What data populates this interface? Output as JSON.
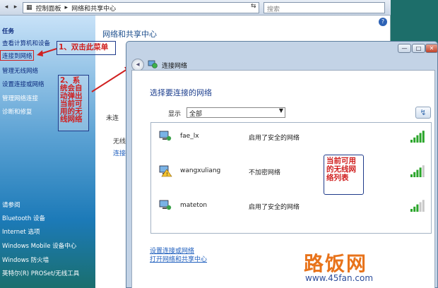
{
  "addressbar": {
    "back_label": "◂",
    "forward_label": "▸",
    "crumb1": "控制面板",
    "crumb2": "网络和共享中心",
    "search_placeholder": "搜索"
  },
  "sidebar": {
    "tasks_label": "任务",
    "items": [
      "查看计算机和设备",
      "连接到网络",
      "管理无线网络",
      "设置连接或网络",
      "管理网络连接",
      "诊断和修复"
    ],
    "see_also_label": "请参阅",
    "see_also": [
      "Bluetooth 设备",
      "Internet 选项",
      "Windows Mobile 设备中心",
      "Windows 防火墙",
      "英特尔(R) PROSet/无线工具"
    ]
  },
  "main": {
    "title": "网络和共享中心",
    "frag1": "未连",
    "frag2": "无线",
    "frag3": "连接"
  },
  "annotations": {
    "step1": "1、双击此菜单",
    "step2": "2、系统会自动弹出当前可用的无线网络",
    "step3": "当前可用的无线网络列表"
  },
  "dialog": {
    "title": "连接网络",
    "heading": "选择要连接的网络",
    "show_label": "显示",
    "show_value": "全部",
    "refresh_icon": "refresh-icon",
    "networks": [
      {
        "name": "fae_lx",
        "status": "启用了安全的网络",
        "signal": 5,
        "secured": true
      },
      {
        "name": "wangxuliang",
        "status": "不加密网络",
        "signal": 4,
        "secured": false
      },
      {
        "name": "mateton",
        "status": "启用了安全的网络",
        "signal": 3,
        "secured": true
      }
    ],
    "link1": "设置连接或网络",
    "link2": "打开网络和共享中心"
  },
  "watermark": {
    "text": "路饭网",
    "url": "www.45fan.com"
  },
  "colors": {
    "annotation_red": "#d02020",
    "link_blue": "#1c5dbd",
    "signal_green": "#2aa52a"
  }
}
